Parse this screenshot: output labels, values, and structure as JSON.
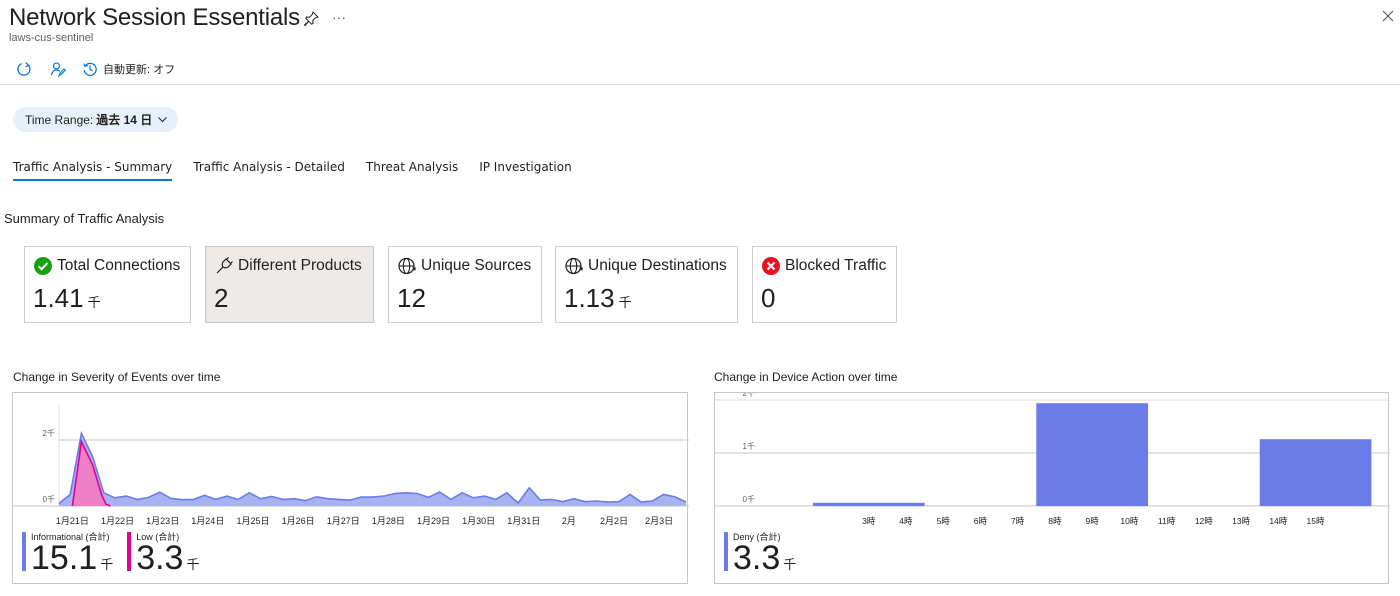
{
  "header": {
    "title": "Network Session Essentials",
    "subtitle": "laws-cus-sentinel",
    "more": "···"
  },
  "toolbar": {
    "auto_refresh_label": "自動更新: オフ"
  },
  "time_range": {
    "label": "Time Range:",
    "value": "過去 14 日"
  },
  "tabs": [
    {
      "label": "Traffic Analysis - Summary",
      "active": true
    },
    {
      "label": "Traffic Analysis - Detailed",
      "active": false
    },
    {
      "label": "Threat Analysis",
      "active": false
    },
    {
      "label": "IP Investigation",
      "active": false
    }
  ],
  "section_title": "Summary of Traffic Analysis",
  "tiles": [
    {
      "label": "Total Connections",
      "value": "1.41",
      "unit": "千",
      "icon": "check-circle-icon",
      "color": "#13a10e"
    },
    {
      "label": "Different Products",
      "value": "2",
      "unit": "",
      "icon": "plug-icon",
      "color": "#201f1e"
    },
    {
      "label": "Unique Sources",
      "value": "12",
      "unit": "",
      "icon": "globe-arrow-icon",
      "color": "#201f1e"
    },
    {
      "label": "Unique Destinations",
      "value": "1.13",
      "unit": "千",
      "icon": "globe-arrow-icon",
      "color": "#201f1e"
    },
    {
      "label": "Blocked Traffic",
      "value": "0",
      "unit": "",
      "icon": "error-circle-icon",
      "color": "#e81123"
    }
  ],
  "charts": {
    "severity": {
      "title": "Change in Severity of Events over time",
      "legend": [
        {
          "label": "Informational (合計)",
          "value": "15.1",
          "unit": "千",
          "color": "#6b7ce8"
        },
        {
          "label": "Low (合計)",
          "value": "3.3",
          "unit": "千",
          "color": "#e3008c"
        }
      ]
    },
    "device_action": {
      "title": "Change in Device Action over time",
      "legend": [
        {
          "label": "Deny (合計)",
          "value": "3.3",
          "unit": "千",
          "color": "#6b7ce8"
        }
      ]
    }
  },
  "chart_data": [
    {
      "type": "area",
      "title": "Change in Severity of Events over time",
      "y_ticks": [
        "0千",
        "2千"
      ],
      "ylim": [
        0,
        3000
      ],
      "x_tick_labels": [
        "1月21日",
        "1月22日",
        "1月23日",
        "1月24日",
        "1月25日",
        "1月26日",
        "1月27日",
        "1月28日",
        "1月29日",
        "1月30日",
        "1月31日",
        "2月",
        "2月2日",
        "2月3日"
      ],
      "x_range": [
        0,
        14
      ],
      "series": [
        {
          "name": "Informational",
          "color": "#6b7ce8",
          "x": [
            0,
            0.25,
            0.5,
            0.75,
            1,
            1.25,
            1.5,
            1.75,
            2,
            2.25,
            2.5,
            2.75,
            3,
            3.25,
            3.5,
            3.75,
            4,
            4.25,
            4.5,
            4.75,
            5,
            5.25,
            5.5,
            5.75,
            6,
            6.25,
            6.5,
            6.75,
            7,
            7.25,
            7.5,
            7.75,
            8,
            8.25,
            8.5,
            8.75,
            9,
            9.25,
            9.5,
            9.75,
            10,
            10.25,
            10.5,
            10.75,
            11,
            11.25,
            11.5,
            11.75,
            12,
            12.25,
            12.5,
            12.75,
            13,
            13.25,
            13.5,
            13.75,
            14
          ],
          "values": [
            80,
            350,
            2200,
            1500,
            400,
            250,
            300,
            200,
            260,
            420,
            230,
            190,
            200,
            320,
            200,
            300,
            200,
            400,
            220,
            290,
            200,
            220,
            160,
            280,
            220,
            200,
            180,
            270,
            270,
            300,
            380,
            400,
            380,
            260,
            420,
            200,
            400,
            250,
            300,
            200,
            400,
            90,
            550,
            180,
            200,
            130,
            220,
            130,
            150,
            120,
            130,
            350,
            120,
            150,
            350,
            280,
            120
          ]
        },
        {
          "name": "Low",
          "color": "#e3008c",
          "x": [
            0.3,
            0.5,
            0.75,
            0.95,
            1.05,
            1.15
          ],
          "values": [
            0,
            1950,
            1250,
            350,
            50,
            0
          ]
        }
      ]
    },
    {
      "type": "bar",
      "title": "Change in Device Action over time",
      "y_ticks": [
        "0千",
        "1千",
        "2千"
      ],
      "ylim": [
        0,
        2000
      ],
      "x_tick_labels": [
        "3時",
        "4時",
        "5時",
        "6時",
        "7時",
        "8時",
        "9時",
        "10時",
        "11時",
        "12時",
        "13時",
        "14時",
        "15時"
      ],
      "series": [
        {
          "name": "Deny",
          "color": "#6b7ce8",
          "bars": [
            {
              "start_hour": 1.5,
              "end_hour": 4.5,
              "value": 60
            },
            {
              "start_hour": 7.5,
              "end_hour": 10.5,
              "value": 1940
            },
            {
              "start_hour": 13.5,
              "end_hour": 16.5,
              "value": 1260
            }
          ]
        }
      ]
    }
  ]
}
